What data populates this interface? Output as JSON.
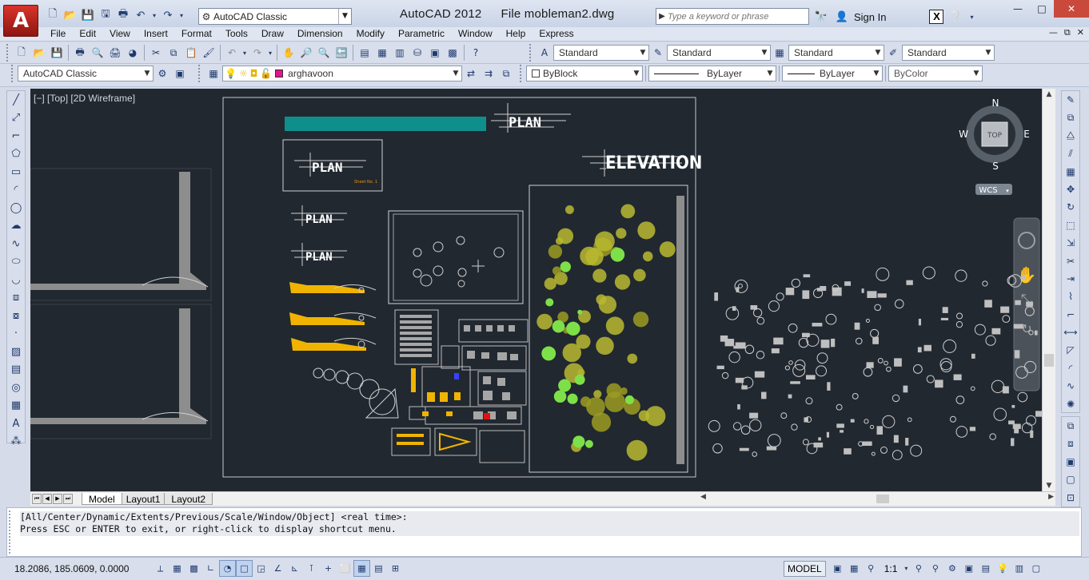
{
  "app": {
    "logo_letter": "A",
    "title": "AutoCAD 2012",
    "file_label": "File mobleman2.dwg"
  },
  "workspace": {
    "value": "AutoCAD Classic"
  },
  "search": {
    "placeholder": "Type a keyword or phrase"
  },
  "user": {
    "sign_in": "Sign In"
  },
  "menu": [
    "File",
    "Edit",
    "View",
    "Insert",
    "Format",
    "Tools",
    "Draw",
    "Dimension",
    "Modify",
    "Parametric",
    "Window",
    "Help",
    "Express"
  ],
  "styles": {
    "text_style": "Standard",
    "dim_style": "Standard",
    "table_style": "Standard",
    "mleader_style": "Standard"
  },
  "props": {
    "workspace2": "AutoCAD Classic",
    "layer": "arghavoon",
    "layer_color": "#e0178b",
    "color": "ByBlock",
    "linetype": "ByLayer",
    "lineweight": "ByLayer",
    "plotstyle": "ByColor"
  },
  "viewport": {
    "label": "[−] [Top] [2D Wireframe]",
    "bg": "#212830"
  },
  "viewcube": {
    "north": "N",
    "south": "S",
    "east": "E",
    "west": "W",
    "top": "TOP",
    "wcs": "WCS"
  },
  "drawing": {
    "elevation_text": "ELEVATION",
    "plan_text": "PLAN",
    "sheet_label": "Sheet No. 1",
    "teal": "#0f8f8c",
    "yellow": "#f0b400",
    "green": "#7ee048"
  },
  "tabs": [
    "Model",
    "Layout1",
    "Layout2"
  ],
  "command": {
    "line1": "[All/Center/Dynamic/Extents/Previous/Scale/Window/Object] <real time>:",
    "line2": "Press ESC or ENTER to exit, or right-click to display shortcut menu.",
    "input": ""
  },
  "status": {
    "coords": "18.2086, 185.0609, 0.0000",
    "model": "MODEL",
    "scale": "1:1"
  }
}
